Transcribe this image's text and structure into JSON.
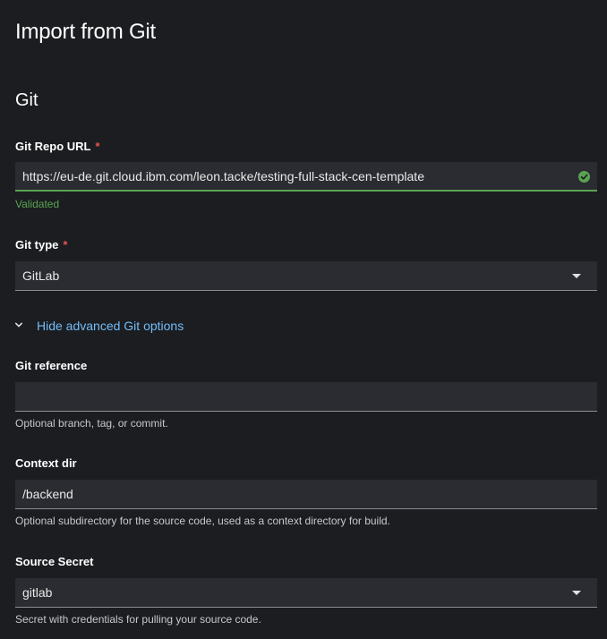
{
  "page": {
    "title": "Import from Git",
    "section_title": "Git"
  },
  "git_repo_url": {
    "label": "Git Repo URL",
    "required_marker": "*",
    "value": "https://eu-de.git.cloud.ibm.com/leon.tacke/testing-full-stack-cen-template",
    "status_text": "Validated",
    "status_icon": "check-circle-icon",
    "status_color": "#5ba352"
  },
  "git_type": {
    "label": "Git type",
    "required_marker": "*",
    "selected": "GitLab"
  },
  "advanced_toggle": {
    "label": "Hide advanced Git options",
    "icon": "chevron-down-icon"
  },
  "git_reference": {
    "label": "Git reference",
    "value": "",
    "helper": "Optional branch, tag, or commit."
  },
  "context_dir": {
    "label": "Context dir",
    "value": "/backend",
    "helper": "Optional subdirectory for the source code, used as a context directory for build."
  },
  "source_secret": {
    "label": "Source Secret",
    "selected": "gitlab",
    "helper": "Secret with credentials for pulling your source code."
  },
  "colors": {
    "background": "#1b1d21",
    "field": "#2a2c31",
    "link": "#73bcf7",
    "required": "#e8544f",
    "success": "#5ba352"
  }
}
